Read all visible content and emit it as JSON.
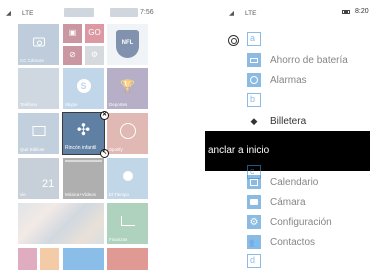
{
  "left_screen": {
    "status": {
      "network": "LTE",
      "time": "7:56"
    },
    "tiles": {
      "camera": {
        "label": "CC Cámara",
        "icon": "camera-icon",
        "color": "#8aa3bf"
      },
      "small_1": {
        "icon": "photo-icon",
        "color": "#9e4155"
      },
      "small_2": {
        "label": "GO",
        "color": "#c0475a"
      },
      "small_3": {
        "icon": "blocked-icon",
        "color": "#9e4155"
      },
      "small_4": {
        "icon": "settings-icon",
        "color": "#b5bcc6"
      },
      "nfl": {
        "logo_text": "NFL",
        "color": "#1c3a6e"
      },
      "telefono": {
        "label": "Teléfono",
        "color": "#a8b8c8"
      },
      "skype": {
        "label": "Skype",
        "icon": "skype-icon",
        "color": "#8fb5d8"
      },
      "deportes": {
        "label": "Deportes",
        "icon": "trophy-icon",
        "color": "#7c6e9a"
      },
      "qr": {
        "label": "Qué Bibliote",
        "icon": "tablet-icon",
        "color": "#92a9c0"
      },
      "kids_corner": {
        "label": "Rincón infantil",
        "icon": "pinwheel-icon",
        "color": "#5f7fa3"
      },
      "spotify": {
        "label": "Spotify",
        "icon": "spotify-icon",
        "color": "#c87f78"
      },
      "calendario": {
        "label": "vie",
        "day": "21",
        "color": "#9aaabb"
      },
      "musica": {
        "label": "Música+Vídeos",
        "color": "#6e6e6e"
      },
      "tiempo": {
        "label": "El Tiempo",
        "icon": "sun-icon",
        "color": "#8fb6d5"
      },
      "photos": {
        "label": ""
      },
      "finanzas": {
        "label": "Finanzas",
        "icon": "chart-icon",
        "color": "#6fae8a"
      }
    },
    "edit_badges": {
      "unpin": "✕",
      "resize": "↖"
    }
  },
  "right_screen": {
    "status": {
      "network": "LTE",
      "time": "8:20"
    },
    "letters": {
      "a": "a",
      "b": "b",
      "c": "c",
      "d": "d"
    },
    "apps": {
      "ahorro": "Ahorro de batería",
      "alarmas": "Alarmas",
      "billetera": "Billetera",
      "calendario": "Calendario",
      "camara": "Cámara",
      "configuracion": "Configuración",
      "contactos": "Contactos"
    },
    "context_menu": {
      "pin_to_start": "anclar a inicio"
    }
  }
}
